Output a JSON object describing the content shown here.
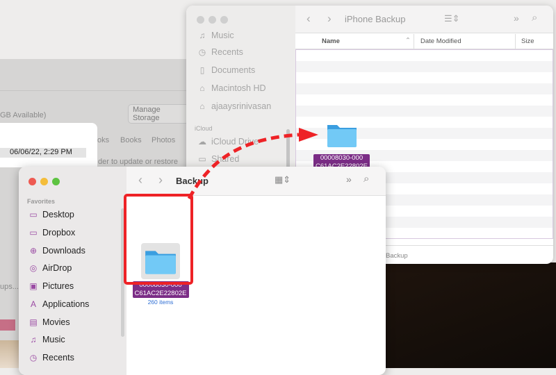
{
  "back_window": {
    "available": "GB Available)",
    "manage_storage": "Manage Storage",
    "tabs": [
      "oks",
      "Books",
      "Photos"
    ],
    "update_text": "der to update or restore",
    "date_row": "06/06/22, 2:29 PM",
    "backups_text": "ups..."
  },
  "iphone_window": {
    "title": "iPhone Backup",
    "sidebar": {
      "items": [
        "Music",
        "Recents",
        "Documents",
        "Macintosh HD",
        "ajaaysrinivasan"
      ],
      "section": "iCloud",
      "icloud_items": [
        "iCloud Drive",
        "Shared"
      ]
    },
    "columns": [
      "Name",
      "Date Modified",
      "Size"
    ],
    "folder_label_1": "00008030-000",
    "folder_label_2": "C61AC2E22802E",
    "status": "Backup"
  },
  "backup_window": {
    "title": "Backup",
    "sidebar": {
      "section": "Favorites",
      "items": [
        "Desktop",
        "Dropbox",
        "Downloads",
        "AirDrop",
        "Pictures",
        "Applications",
        "Movies",
        "Music",
        "Recents"
      ]
    },
    "folder_label_1": "00008030-000",
    "folder_label_2": "C61AC2E22802E",
    "folder_count": "260 items"
  },
  "colors": {
    "accent_red": "#ee2226",
    "selection": "#7b2d86",
    "folder": "#6cc4f5"
  }
}
